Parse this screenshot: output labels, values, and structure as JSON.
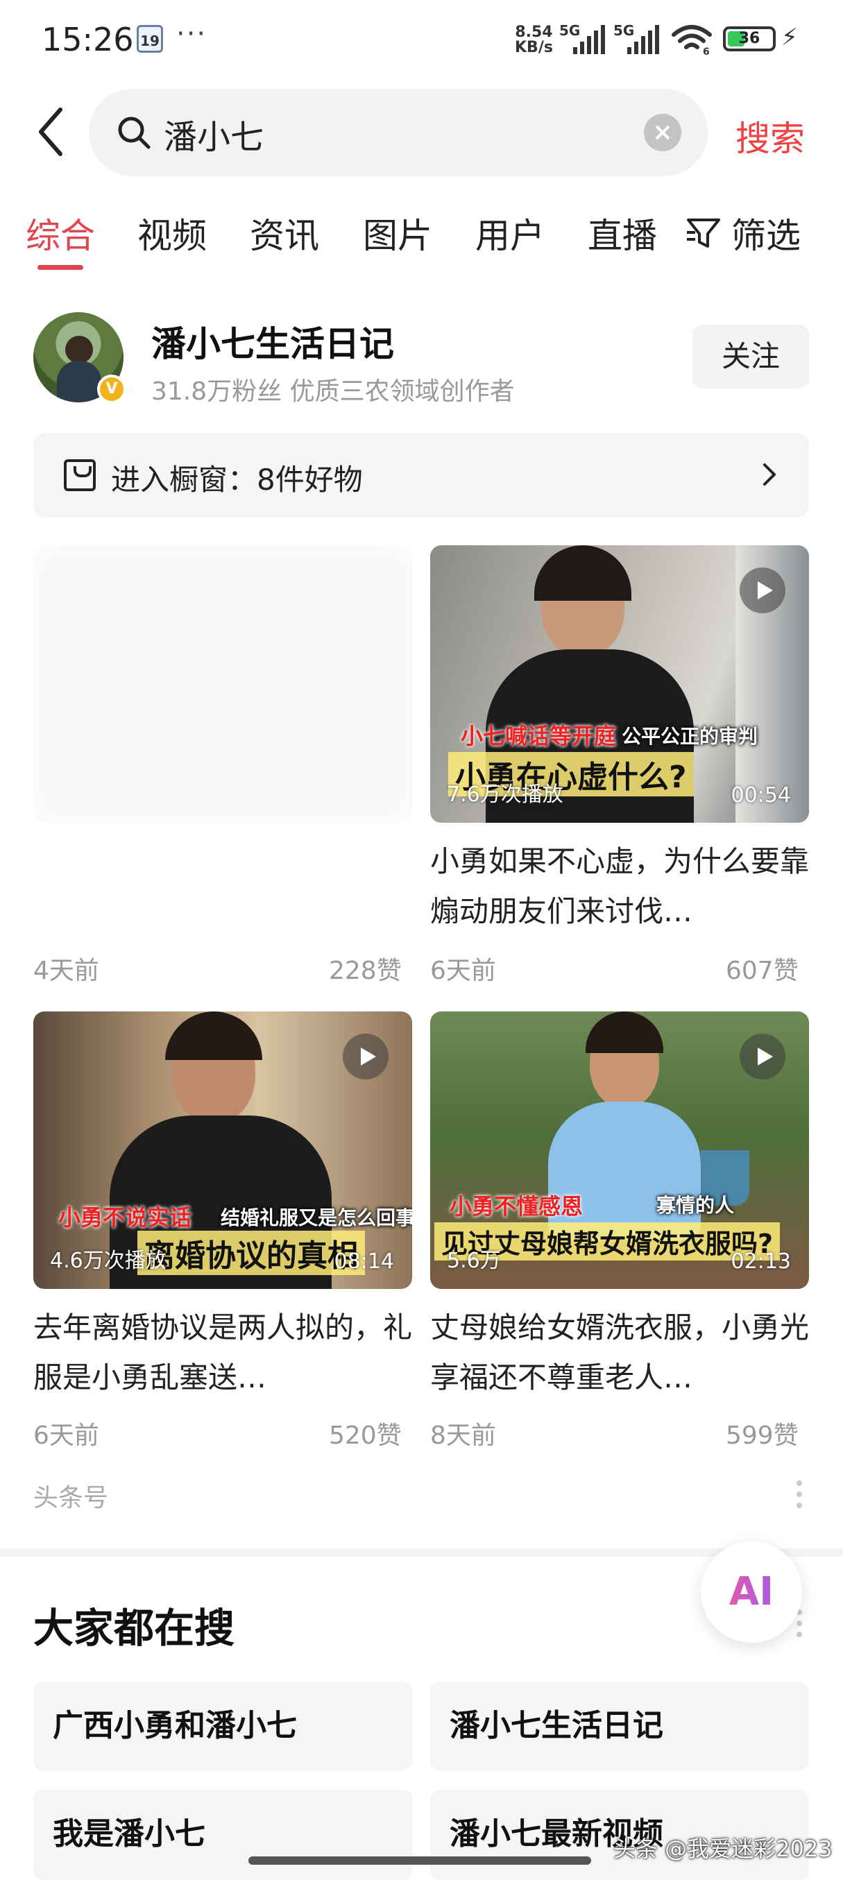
{
  "status_bar": {
    "time": "15:26",
    "calendar_day": "19",
    "more": "···",
    "net_speed_value": "8.54",
    "net_speed_unit": "KB/s",
    "sim1": "5G",
    "sim2": "5G",
    "wifi_label": "6",
    "battery": "36"
  },
  "search": {
    "query": "潘小七",
    "submit_label": "搜索"
  },
  "tabs": {
    "items": [
      {
        "label": "综合",
        "active": true
      },
      {
        "label": "视频",
        "active": false
      },
      {
        "label": "资讯",
        "active": false
      },
      {
        "label": "图片",
        "active": false
      },
      {
        "label": "用户",
        "active": false
      },
      {
        "label": "直播",
        "active": false
      }
    ],
    "filter_label": "筛选"
  },
  "author": {
    "name": "潘小七生活日记",
    "meta": "31.8万粉丝 优质三农领域创作者",
    "follow_label": "关注",
    "badge": "V",
    "shop_text": "进入橱窗：8件好物"
  },
  "videos": [
    {
      "title": "",
      "age": "4天前",
      "likes": "228赞"
    },
    {
      "title": "小勇如果不心虚，为什么要靠煽动朋友们来讨伐…",
      "age": "6天前",
      "likes": "607赞",
      "plays": "7.6万次播放",
      "duration": "00:54",
      "caption_red": "小七喊话等开庭",
      "caption_white": "公平公正的审判",
      "caption_big": "小勇在心虚什么?"
    },
    {
      "title": "去年离婚协议是两人拟的，礼服是小勇乱塞送…",
      "age": "6天前",
      "likes": "520赞",
      "plays": "4.6万次播放",
      "duration": "08:14",
      "caption_red": "小勇不说实话",
      "caption_white": "结婚礼服又是怎么回事",
      "caption_big": "离婚协议的真相"
    },
    {
      "title": "丈母娘给女婿洗衣服，小勇光享福还不尊重老人…",
      "age": "8天前",
      "likes": "599赞",
      "plays": "5.6万",
      "duration": "02:13",
      "caption_red": "小勇不懂感恩",
      "caption_white": "寡情的人",
      "caption_big": "见过丈母娘帮女婿洗衣服吗?"
    }
  ],
  "source_label": "头条号",
  "related": {
    "title": "大家都在搜",
    "items": [
      "广西小勇和潘小七",
      "潘小七生活日记",
      "我是潘小七",
      "潘小七最新视频"
    ]
  },
  "ai_button": "AI",
  "watermark": "头条 @我爱迷彩2023",
  "colors": {
    "accent": "#e0464f",
    "search_submit": "#f04142",
    "badge": "#f3b21a",
    "battery": "#35c759"
  }
}
